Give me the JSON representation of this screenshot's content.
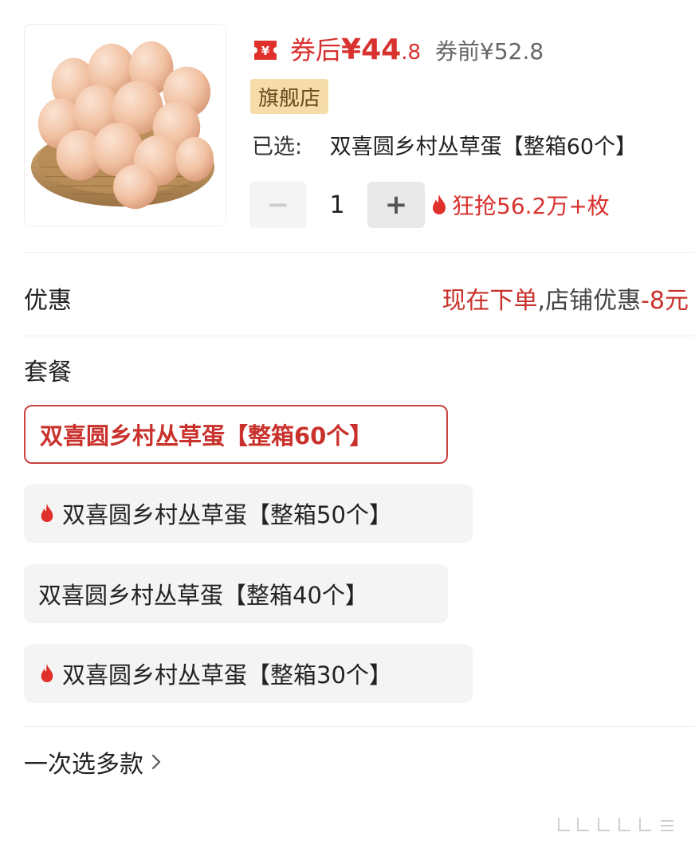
{
  "product": {
    "image_alt": "egg-basket",
    "price_after_label": "券后",
    "currency": "¥",
    "price_after_int": "44",
    "price_after_dec": ".8",
    "price_before": "券前¥52.8",
    "badge": "旗舰店",
    "selected_label": "已选:",
    "selected_value": "双喜圆乡村丛草蛋【整箱60个】",
    "quantity": "1",
    "minus_label": "−",
    "plus_label": "+",
    "hot_text": "狂抢56.2万+枚"
  },
  "promo": {
    "label": "优惠",
    "value_red": "现在下单",
    "value_gray": ",店铺优惠",
    "value_amount": "-8元"
  },
  "packages": {
    "label": "套餐",
    "options": [
      {
        "label": "双喜圆乡村丛草蛋【整箱60个】",
        "selected": true,
        "hot": false
      },
      {
        "label": "双喜圆乡村丛草蛋【整箱50个】",
        "selected": false,
        "hot": true
      },
      {
        "label": "双喜圆乡村丛草蛋【整箱40个】",
        "selected": false,
        "hot": false
      },
      {
        "label": "双喜圆乡村丛草蛋【整箱30个】",
        "selected": false,
        "hot": true
      }
    ]
  },
  "multi_select": {
    "label": "一次选多款"
  },
  "colors": {
    "accent_red": "#d8322f",
    "badge_bg": "#f6dca8",
    "option_bg": "#f4f4f4"
  },
  "icons": {
    "coupon": "coupon-yen-icon",
    "flame": "flame-icon",
    "chevron": "chevron-right-icon"
  }
}
